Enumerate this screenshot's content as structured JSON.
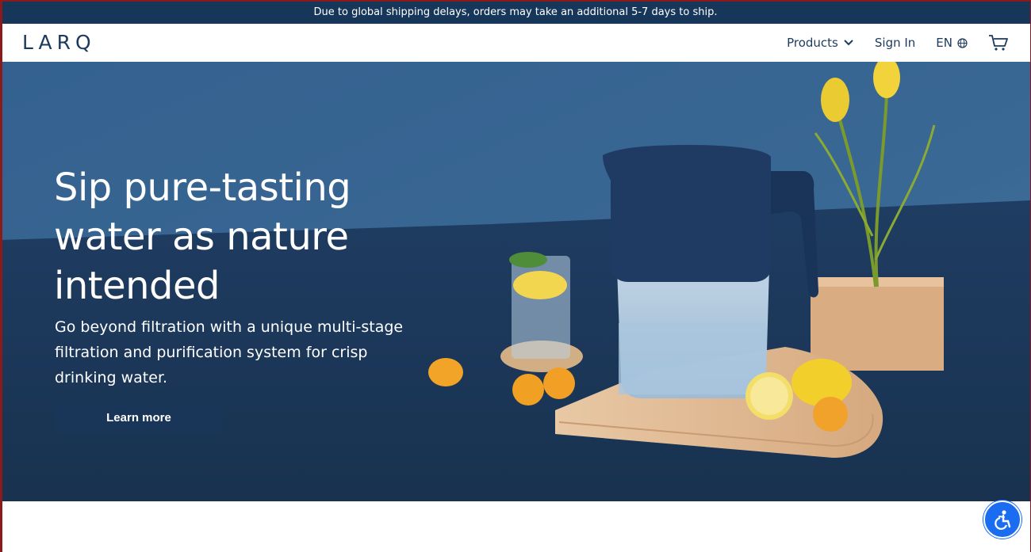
{
  "announcement": {
    "text": "Due to global shipping delays, orders may take an additional 5-7 days to ship."
  },
  "header": {
    "logo": "LARQ",
    "nav": {
      "products": "Products",
      "sign_in": "Sign In",
      "language": "EN"
    },
    "icons": {
      "products_caret": "chevron-down-icon",
      "language": "globe-icon",
      "cart": "cart-icon"
    }
  },
  "hero": {
    "headline": "Sip pure-tasting water as nature intended",
    "subhead": "Go beyond filtration with a unique multi-stage filtration and purification system for crisp drinking water.",
    "cta_label": "Learn more",
    "image_alt": "LARQ pitcher with lemons, kumquats, a glass of water and yellow tulips"
  },
  "accessibility": {
    "icon": "accessibility-icon"
  },
  "colors": {
    "navy": "#16365a",
    "hero_bg": "#1d3a5f",
    "text_dark": "#1c3a5e",
    "a11y_blue": "#1a6cf0"
  }
}
